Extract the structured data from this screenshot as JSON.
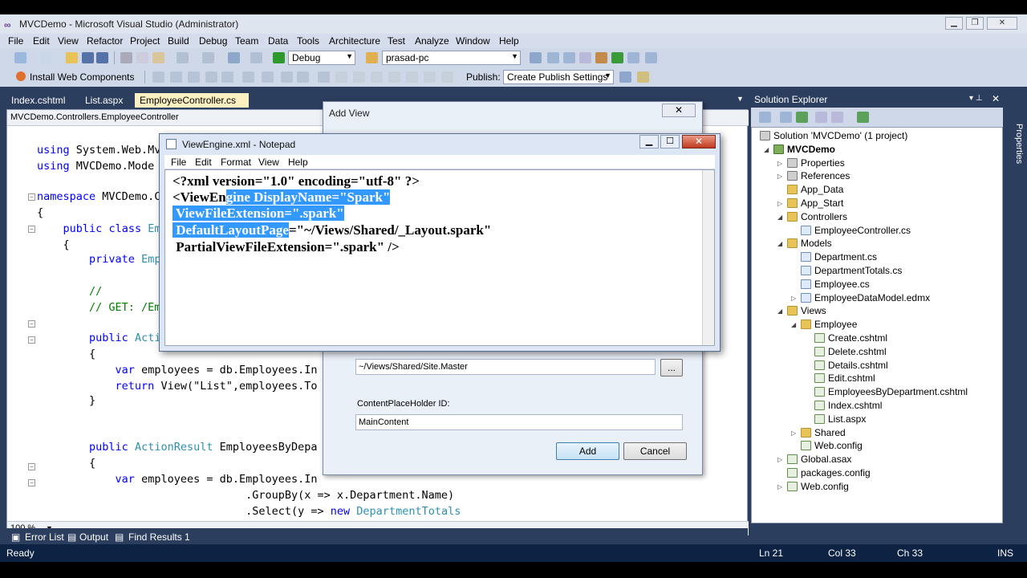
{
  "window": {
    "title": "MVCDemo - Microsoft Visual Studio (Administrator)",
    "logo": "∞"
  },
  "menu": [
    "File",
    "Edit",
    "View",
    "Refactor",
    "Project",
    "Build",
    "Debug",
    "Team",
    "Data",
    "Tools",
    "Architecture",
    "Test",
    "Analyze",
    "Window",
    "Help"
  ],
  "toolbar": {
    "config": "Debug",
    "platform": "prasad-pc",
    "install_web_components": "Install Web Components",
    "publish_label": "Publish:",
    "publish_setting": "Create Publish Settings"
  },
  "tabs": [
    "Index.cshtml",
    "List.aspx",
    "EmployeeController.cs"
  ],
  "editor": {
    "nav": "MVCDemo.Controllers.EmployeeController",
    "zoom": "100 %",
    "lines": [
      {
        "kind": "plain",
        "indent": "",
        "parts": [
          [
            "kw",
            "using"
          ],
          [
            "plain",
            " System.Web.Mv"
          ]
        ]
      },
      {
        "kind": "plain",
        "indent": "",
        "parts": [
          [
            "kw",
            "using"
          ],
          [
            "plain",
            " MVCDemo.Mode"
          ]
        ]
      },
      {
        "kind": "plain",
        "indent": "",
        "parts": [
          [
            "kw",
            "namespace"
          ],
          [
            "plain",
            " MVCDemo.C"
          ]
        ]
      },
      {
        "kind": "plain",
        "indent": "",
        "parts": [
          [
            "plain",
            "{"
          ]
        ]
      },
      {
        "kind": "plain",
        "indent": "    ",
        "parts": [
          [
            "kw",
            "public"
          ],
          [
            "plain",
            " "
          ],
          [
            "kw",
            "class"
          ],
          [
            "plain",
            " "
          ],
          [
            "ty",
            "Em"
          ]
        ]
      },
      {
        "kind": "plain",
        "indent": "    ",
        "parts": [
          [
            "plain",
            "{"
          ]
        ]
      },
      {
        "kind": "plain",
        "indent": "        ",
        "parts": [
          [
            "kw",
            "private"
          ],
          [
            "plain",
            " "
          ],
          [
            "ty",
            "Emp"
          ]
        ]
      },
      {
        "kind": "plain",
        "indent": "        ",
        "parts": [
          [
            "cm",
            "//"
          ]
        ]
      },
      {
        "kind": "plain",
        "indent": "        ",
        "parts": [
          [
            "cm",
            "// GET: /Em"
          ]
        ]
      },
      {
        "kind": "plain",
        "indent": "        ",
        "parts": [
          [
            "kw",
            "public"
          ],
          [
            "plain",
            " "
          ],
          [
            "ty",
            "Acti"
          ]
        ]
      },
      {
        "kind": "plain",
        "indent": "        ",
        "parts": [
          [
            "plain",
            "{"
          ]
        ]
      },
      {
        "kind": "plain",
        "indent": "            ",
        "parts": [
          [
            "kw",
            "var"
          ],
          [
            "plain",
            " employees = db.Employees.In"
          ]
        ]
      },
      {
        "kind": "plain",
        "indent": "            ",
        "parts": [
          [
            "kw",
            "return"
          ],
          [
            "plain",
            " View(\"List\",employees.To"
          ]
        ]
      },
      {
        "kind": "plain",
        "indent": "        ",
        "parts": [
          [
            "plain",
            "}"
          ]
        ]
      },
      {
        "kind": "plain",
        "indent": "        ",
        "parts": [
          [
            "kw",
            "public"
          ],
          [
            "plain",
            " "
          ],
          [
            "ty",
            "ActionResult"
          ],
          [
            "plain",
            " EmployeesByDepa"
          ]
        ]
      },
      {
        "kind": "plain",
        "indent": "        ",
        "parts": [
          [
            "plain",
            "{"
          ]
        ]
      },
      {
        "kind": "plain",
        "indent": "            ",
        "parts": [
          [
            "kw",
            "var"
          ],
          [
            "plain",
            " employees = db.Employees.In"
          ]
        ]
      },
      {
        "kind": "plain",
        "indent": "                                ",
        "parts": [
          [
            "plain",
            ".GroupBy(x => x.Department.Name)"
          ]
        ]
      },
      {
        "kind": "plain",
        "indent": "                                ",
        "parts": [
          [
            "plain",
            ".Select(y => "
          ],
          [
            "kw",
            "new"
          ],
          [
            "plain",
            " "
          ],
          [
            "ty",
            "DepartmentTotals"
          ]
        ]
      }
    ]
  },
  "bottom_tabs": [
    "Error List",
    "Output",
    "Find Results 1"
  ],
  "status": {
    "ready": "Ready",
    "ln": "Ln 21",
    "col": "Col 33",
    "ch": "Ch 33",
    "ins": "INS"
  },
  "solution_explorer": {
    "title": "Solution Explorer",
    "tree": [
      {
        "label": "Solution 'MVCDemo' (1 project)",
        "depth": 0,
        "icon": "gear",
        "exp": ""
      },
      {
        "label": "MVCDemo",
        "depth": 1,
        "icon": "proj",
        "exp": "◢",
        "bold": true
      },
      {
        "label": "Properties",
        "depth": 2,
        "icon": "gear",
        "exp": "▷"
      },
      {
        "label": "References",
        "depth": 2,
        "icon": "gear",
        "exp": "▷"
      },
      {
        "label": "App_Data",
        "depth": 2,
        "icon": "folder",
        "exp": ""
      },
      {
        "label": "App_Start",
        "depth": 2,
        "icon": "folder",
        "exp": "▷"
      },
      {
        "label": "Controllers",
        "depth": 2,
        "icon": "folder",
        "exp": "◢"
      },
      {
        "label": "EmployeeController.cs",
        "depth": 3,
        "icon": "file-cs",
        "exp": ""
      },
      {
        "label": "Models",
        "depth": 2,
        "icon": "folder",
        "exp": "◢"
      },
      {
        "label": "Department.cs",
        "depth": 3,
        "icon": "file-cs",
        "exp": ""
      },
      {
        "label": "DepartmentTotals.cs",
        "depth": 3,
        "icon": "file-cs",
        "exp": ""
      },
      {
        "label": "Employee.cs",
        "depth": 3,
        "icon": "file-cs",
        "exp": ""
      },
      {
        "label": "EmployeeDataModel.edmx",
        "depth": 3,
        "icon": "file-cs",
        "exp": "▷"
      },
      {
        "label": "Views",
        "depth": 2,
        "icon": "folder",
        "exp": "◢"
      },
      {
        "label": "Employee",
        "depth": 3,
        "icon": "folder",
        "exp": "◢"
      },
      {
        "label": "Create.cshtml",
        "depth": 4,
        "icon": "file-ht",
        "exp": ""
      },
      {
        "label": "Delete.cshtml",
        "depth": 4,
        "icon": "file-ht",
        "exp": ""
      },
      {
        "label": "Details.cshtml",
        "depth": 4,
        "icon": "file-ht",
        "exp": ""
      },
      {
        "label": "Edit.cshtml",
        "depth": 4,
        "icon": "file-ht",
        "exp": ""
      },
      {
        "label": "EmployeesByDepartment.cshtml",
        "depth": 4,
        "icon": "file-ht",
        "exp": ""
      },
      {
        "label": "Index.cshtml",
        "depth": 4,
        "icon": "file-ht",
        "exp": ""
      },
      {
        "label": "List.aspx",
        "depth": 4,
        "icon": "file-ht",
        "exp": ""
      },
      {
        "label": "Shared",
        "depth": 3,
        "icon": "folder",
        "exp": "▷"
      },
      {
        "label": "Web.config",
        "depth": 3,
        "icon": "file-ht",
        "exp": ""
      },
      {
        "label": "Global.asax",
        "depth": 2,
        "icon": "file-ht",
        "exp": "▷"
      },
      {
        "label": "packages.config",
        "depth": 2,
        "icon": "file-ht",
        "exp": ""
      },
      {
        "label": "Web.config",
        "depth": 2,
        "icon": "file-ht",
        "exp": "▷"
      }
    ],
    "side_tab": "Properties"
  },
  "add_view": {
    "title": "Add View",
    "master_page": "~/Views/Shared/Site.Master",
    "browse": "...",
    "placeholder_label": "ContentPlaceHolder ID:",
    "placeholder_value": "MainContent",
    "add": "Add",
    "cancel": "Cancel"
  },
  "notepad": {
    "title": "ViewEngine.xml - Notepad",
    "menu": [
      "File",
      "Edit",
      "Format",
      "View",
      "Help"
    ],
    "l1": "<?xml version=\"1.0\" encoding=\"utf-8\" ?>",
    "l2a": "<ViewEn",
    "l2b": "gine DisplayName=\"Spark\"",
    "l3": " ViewFileExtension=\".spark\"",
    "l4a": " DefaultLayoutPage",
    "l4b": "=\"~/Views/Shared/_Layout.spark\"",
    "l5": " PartialViewFileExtension=\".spark\" />"
  }
}
